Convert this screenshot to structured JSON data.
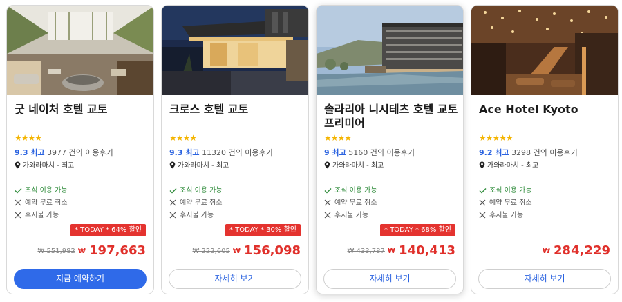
{
  "colors": {
    "accent": "#2f6ae9",
    "score": "#2b63e0",
    "deal_bg": "#e4332f",
    "price": "#e0302b",
    "feature_ok": "#2e8b3a",
    "stars": "#f4b400"
  },
  "icons": {
    "star": "★",
    "location": "location-pin-icon",
    "check": "check-icon",
    "cross": "cross-icon"
  },
  "currency_mark": "₩",
  "hotels": [
    {
      "name": "굿 네이처 호텔 교토",
      "stars": "★★★★",
      "score": "9.3 최고",
      "reviews": "3977 건의 이용후기",
      "location": "가와라마치 - 최고",
      "features": [
        "조식 이용 가능",
        "예약 무료 취소",
        "후지불 가능"
      ],
      "deal": "* TODAY * 64% 할인",
      "old_price": "₩ 551,982",
      "price": "197,663",
      "button": "지금 예약하기"
    },
    {
      "name": "크로스 호텔 교토",
      "stars": "★★★★",
      "score": "9.3 최고",
      "reviews": "11320 건의 이용후기",
      "location": "가와라마치 - 최고",
      "features": [
        "조식 이용 가능",
        "예약 무료 취소",
        "후지불 가능"
      ],
      "deal": "* TODAY * 30% 할인",
      "old_price": "₩ 222,605",
      "price": "156,098",
      "button": "자세히 보기"
    },
    {
      "name": "솔라리아 니시테츠 호텔 교토 프리미어",
      "stars": "★★★★",
      "score": "9 최고",
      "reviews": "5160 건의 이용후기",
      "location": "가와라마치 - 최고",
      "features": [
        "조식 이용 가능",
        "예약 무료 취소",
        "후지불 가능"
      ],
      "deal": "* TODAY * 68% 할인",
      "old_price": "₩ 433,787",
      "price": "140,413",
      "button": "자세히 보기"
    },
    {
      "name": "Ace Hotel Kyoto",
      "stars": "★★★★★",
      "score": "9.2 최고",
      "reviews": "3298 건의 이용후기",
      "location": "가와라마치 - 최고",
      "features": [
        "조식 이용 가능",
        "예약 무료 취소",
        "후지불 가능"
      ],
      "deal": "",
      "old_price": "",
      "price": "284,229",
      "button": "자세히 보기"
    }
  ]
}
